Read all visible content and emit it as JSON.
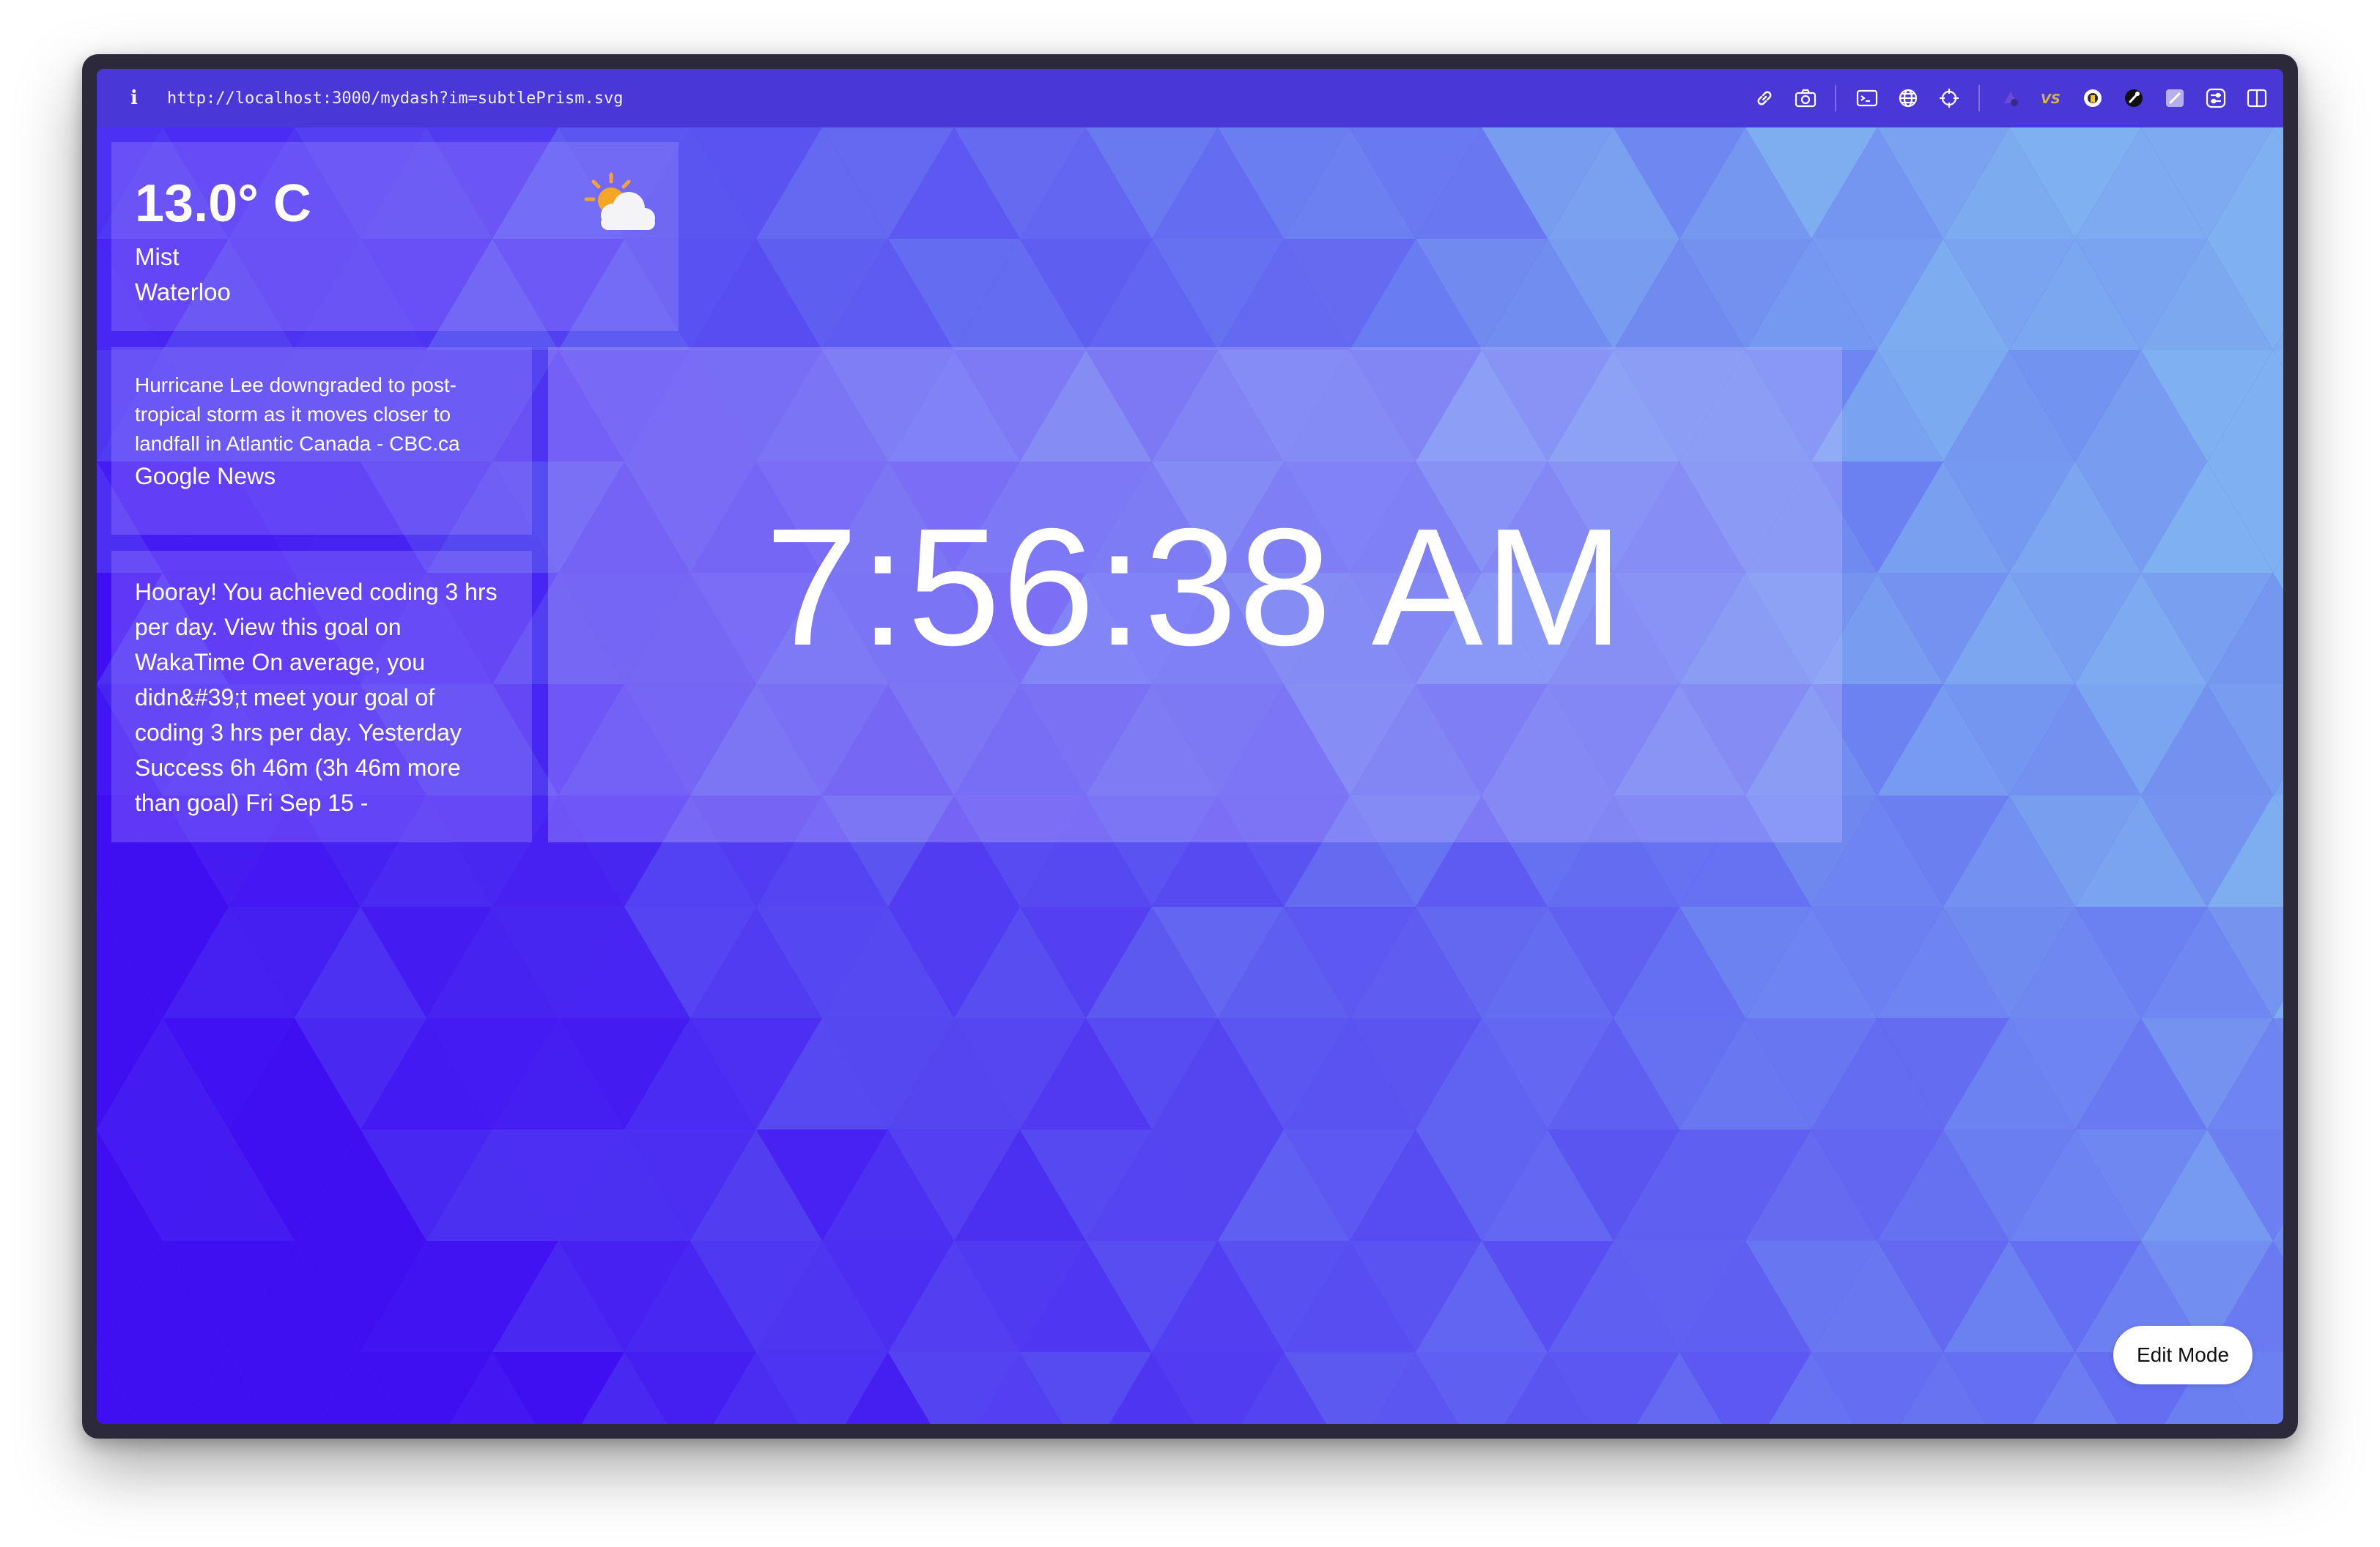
{
  "browser": {
    "url": "http://localhost:3000/mydash?im=subtlePrism.svg",
    "tools": [
      "link-icon",
      "camera-icon",
      "terminal-icon",
      "globe-icon",
      "crosshair-icon"
    ],
    "extensions": [
      "purple-extension-icon",
      "vs-extension-icon",
      "ghost-extension-icon",
      "dark-extension-icon",
      "wand-extension-icon",
      "sliders-extension-icon",
      "sidebar-toggle-icon"
    ],
    "colors": {
      "bar": "#4a38d6"
    }
  },
  "weather": {
    "temperature": "13.0° C",
    "condition": "Mist",
    "city": "Waterloo",
    "icon": "partly-cloudy-icon"
  },
  "news": {
    "headline": "Hurricane Lee downgraded to post-tropical storm as it moves closer to landfall in Atlantic Canada - CBC.ca",
    "source": "Google News"
  },
  "wakatime": {
    "text": "Hooray! You achieved coding 3 hrs per day. View this goal on WakaTime On average, you didn&#39;t meet your goal of coding 3 hrs per day. Yesterday Success 6h 46m (3h 46m more than goal) Fri Sep 15 -"
  },
  "clock": {
    "time": "7:56:38 AM"
  },
  "actions": {
    "edit_mode": "Edit Mode"
  },
  "theme": {
    "bg_dark": "#3f0ff2",
    "bg_light": "#7fb0f0"
  }
}
